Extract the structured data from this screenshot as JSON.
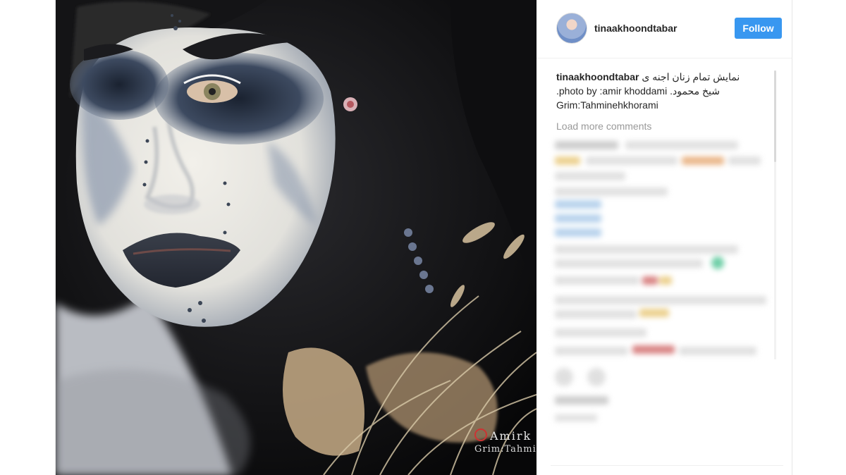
{
  "post": {
    "username": "tinaakhoondtabar",
    "follow_label": "Follow",
    "caption": {
      "user": "tinaakhoondtabar",
      "line1": "نمایش تمام زنان اجنه ی",
      "line2": "شیخ محمود. photo by :amir khoddami.",
      "line3": "Grim:Tahminehkhorami"
    },
    "load_more": "Load more comments"
  },
  "photo": {
    "watermark_line1": "Amirk",
    "watermark_line2": "Grim:Tahmin"
  },
  "colors": {
    "follow_button": "#3897f0",
    "text": "#262626",
    "muted": "#999999"
  }
}
